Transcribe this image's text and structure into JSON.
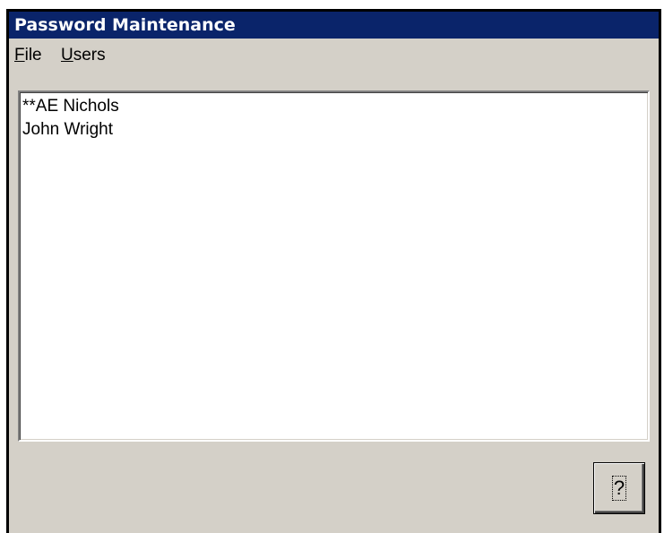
{
  "window": {
    "title": "Password Maintenance"
  },
  "menu": {
    "file": {
      "mnemonic": "F",
      "rest": "ile"
    },
    "users": {
      "mnemonic": "U",
      "rest": "sers"
    }
  },
  "users_list": {
    "items": [
      "**AE Nichols",
      "John Wright"
    ]
  },
  "help_button": {
    "label": "?",
    "icon": "question-mark-icon"
  },
  "colors": {
    "titlebar": "#0a246a",
    "window_bg": "#d4d0c8",
    "list_bg": "#ffffff"
  }
}
